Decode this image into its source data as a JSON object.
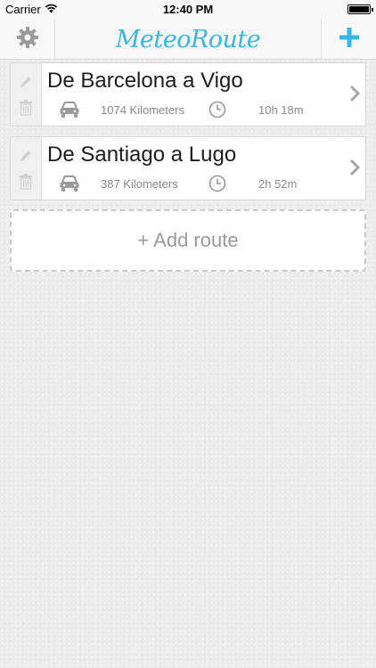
{
  "status_bar": {
    "carrier": "Carrier",
    "time": "12:40 PM",
    "wifi_icon": "wifi-icon",
    "battery_icon": "battery-icon"
  },
  "nav": {
    "title": "MeteoRoute",
    "settings_icon": "gear-icon",
    "add_icon": "plus-icon"
  },
  "routes": [
    {
      "title": "De Barcelona a Vigo",
      "distance": "1074 Kilometers",
      "duration": "10h 18m"
    },
    {
      "title": "De Santiago a Lugo",
      "distance": "387 Kilometers",
      "duration": "2h 52m"
    }
  ],
  "add_route_label": "+ Add route",
  "colors": {
    "accent": "#38b7e6",
    "icon_gray": "#9a9a9a",
    "background": "#ececec"
  }
}
